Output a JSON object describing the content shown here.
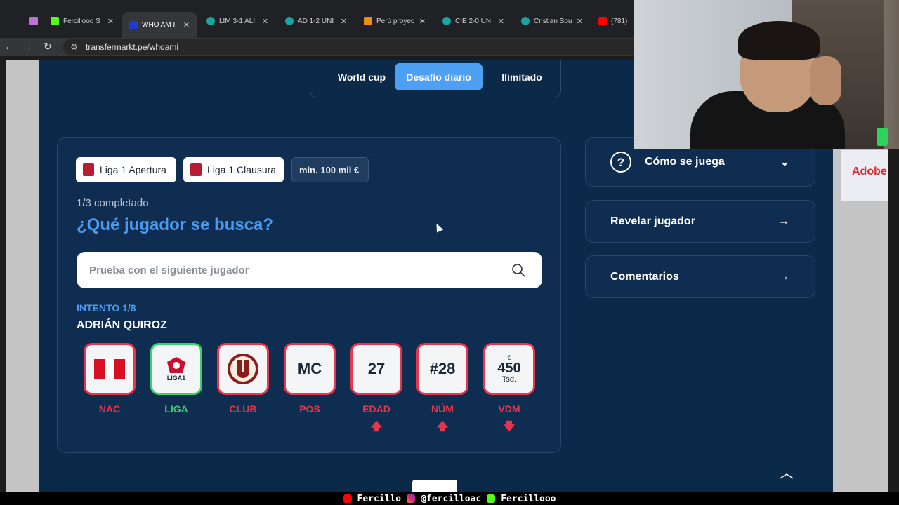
{
  "browser": {
    "tabs": [
      {
        "title": "Fercillooo S",
        "color": "#53fc18"
      },
      {
        "title": "WHO AM I",
        "color": "#1b3bd1",
        "active": true
      },
      {
        "title": "LIM 3-1 ALI",
        "color": "#1aa4a4"
      },
      {
        "title": "AD 1-2 UNI",
        "color": "#1aa4a4"
      },
      {
        "title": "Perú proyec",
        "color": "#f28b16"
      },
      {
        "title": "CIE 2-0 UNI",
        "color": "#1aa4a4"
      },
      {
        "title": "Cristian Sou",
        "color": "#1aa4a4"
      },
      {
        "title": "(781) L",
        "color": "#ff0000"
      }
    ],
    "url": "transfermarkt.pe/whoami"
  },
  "modes": [
    "World cup",
    "Desafío diario",
    "Ilimitado"
  ],
  "filters": {
    "league_a": "Liga 1 Apertura",
    "league_b": "Liga 1 Clausura",
    "min_value": "min. 100 mil €"
  },
  "game": {
    "progress": "1/3 completado",
    "question": "¿Qué jugador se busca?",
    "search_placeholder": "Prueba con el siguiente jugador",
    "attempt": "INTENTO 1/8",
    "player": "ADRIÁN QUIROZ"
  },
  "clues": [
    {
      "label": "NAC",
      "content": "",
      "status": "wrong"
    },
    {
      "label": "LIGA",
      "content": "LIGA1",
      "status": "correct"
    },
    {
      "label": "CLUB",
      "content": "",
      "status": "wrong"
    },
    {
      "label": "POS",
      "content": "MC",
      "status": "wrong"
    },
    {
      "label": "EDAD",
      "content": "27",
      "status": "wrong",
      "arrow": "up"
    },
    {
      "label": "NÚM",
      "content": "#28",
      "status": "wrong",
      "arrow": "up"
    },
    {
      "label": "VDM",
      "content": "450",
      "currency": "€",
      "unit": "Tsd.",
      "status": "wrong",
      "arrow": "down"
    }
  ],
  "side_panels": {
    "how_to_play": "Cómo se juega",
    "reveal_player": "Revelar jugador",
    "comments": "Comentarios"
  },
  "ad_text": "Adobe",
  "footer": {
    "youtube": "Fercillo",
    "instagram": "@fercilloac",
    "kick": "Fercillooo"
  },
  "colors": {
    "accent": "#4da0f4",
    "correct": "#3bd16f",
    "wrong": "#e6354d",
    "site_bg": "#0b2a4a"
  }
}
